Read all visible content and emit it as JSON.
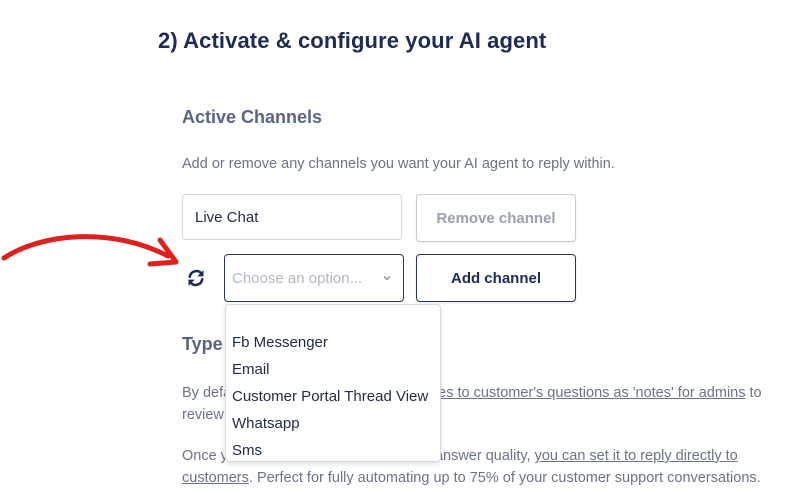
{
  "heading": "2) Activate & configure your AI agent",
  "active_channels": {
    "title": "Active Channels",
    "description": "Add or remove any channels you want your AI agent to reply within.",
    "current_channel": "Live Chat",
    "remove_label": "Remove channel",
    "add_label": "Add channel",
    "select_placeholder": "Choose an option...",
    "options": [
      "Fb Messenger",
      "Email",
      "Customer Portal Thread View",
      "Whatsapp",
      "Sms"
    ]
  },
  "type_section": {
    "title_visible": "Type",
    "para1_start": "By defa",
    "para1_link": "es to customer's questions as 'notes' for admins",
    "para1_end": " to",
    "para1_line2": "review",
    "para2_start": "Once y",
    "para2_mid": "answer quality, ",
    "para2_link1": "you can set it to reply directly to",
    "para2_link2": "customers",
    "para2_end": ". Perfect for fully automating up to 75% of your customer support conversations."
  },
  "colors": {
    "arrow": "#e0201c",
    "primary": "#1f2a55",
    "muted_text": "#6b7385"
  }
}
